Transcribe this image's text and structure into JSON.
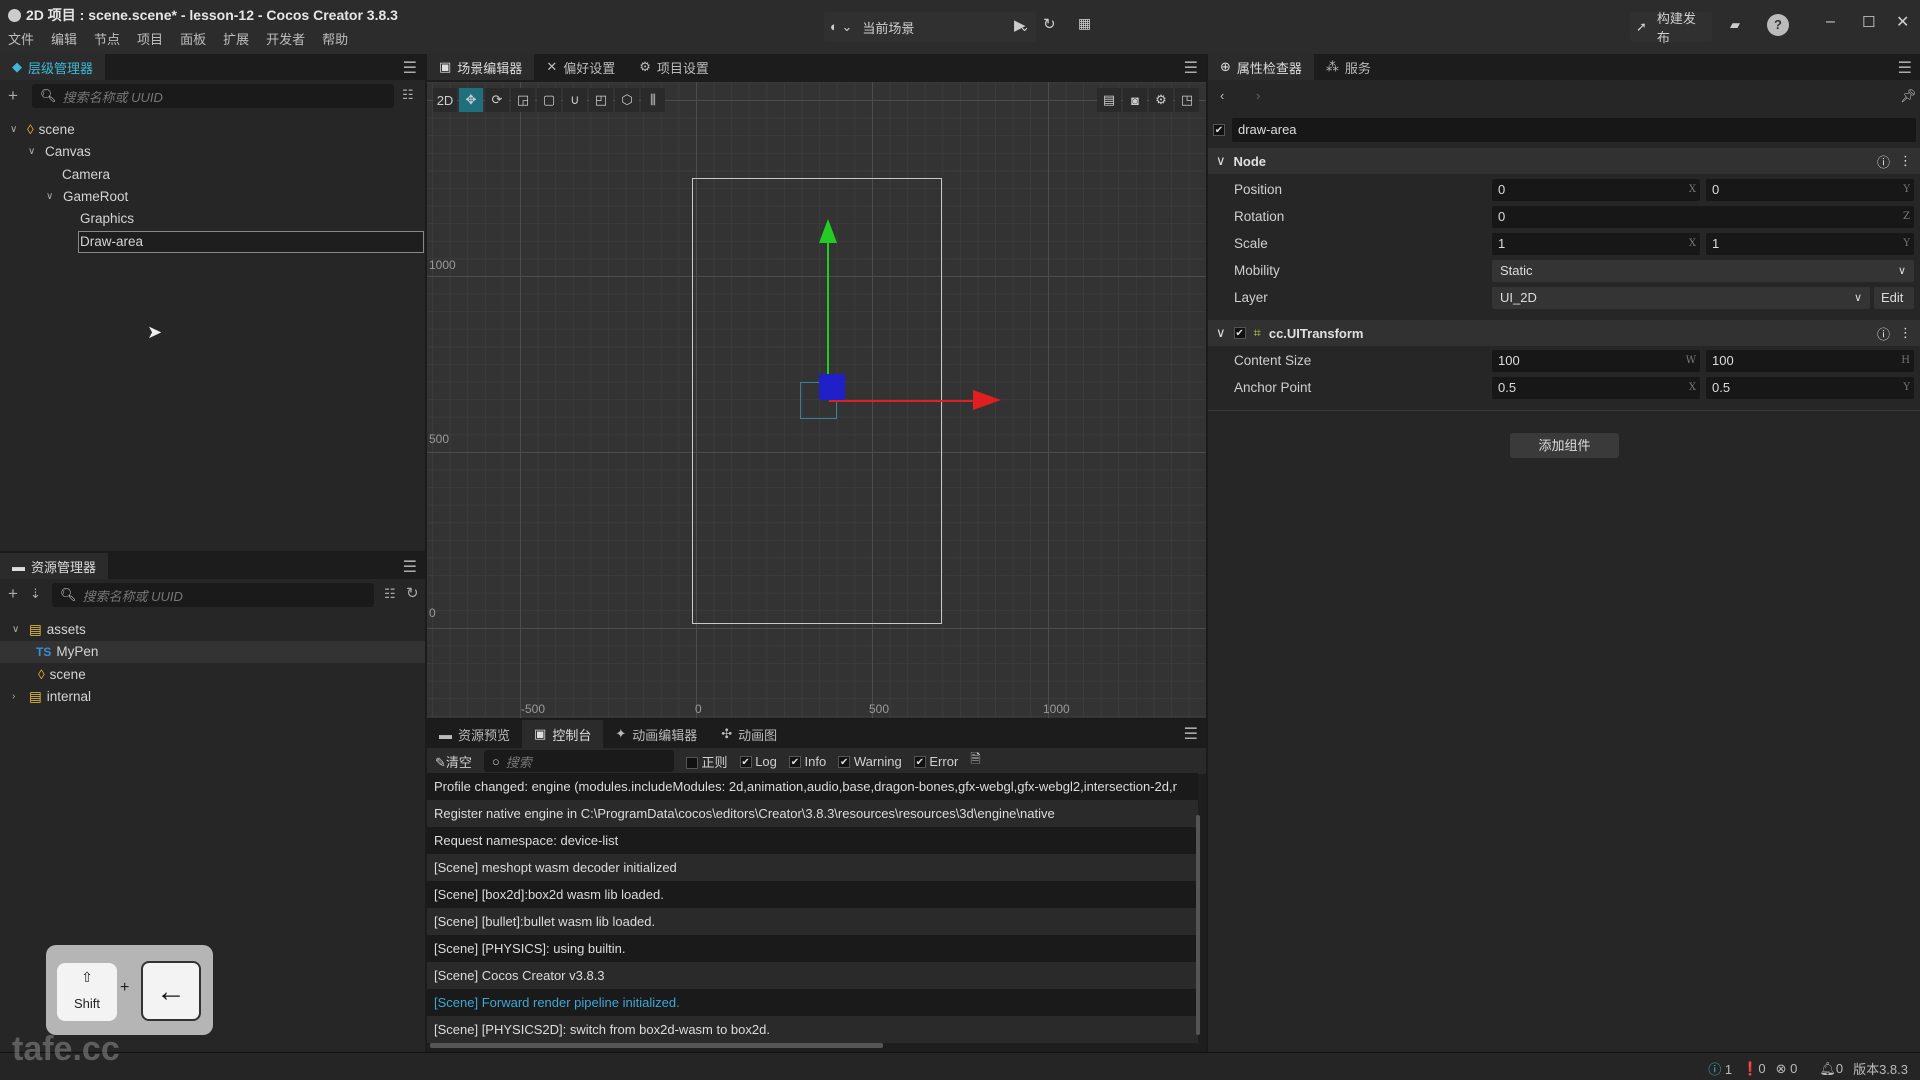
{
  "window": {
    "title": "2D 项目 : scene.scene* - lesson-12 - Cocos Creator 3.8.3"
  },
  "menu": [
    "文件",
    "编辑",
    "节点",
    "项目",
    "面板",
    "扩展",
    "开发者",
    "帮助"
  ],
  "toolbar": {
    "scene_select": "当前场景",
    "build_label": "构建发布"
  },
  "hierarchy": {
    "tab": "层级管理器",
    "search_placeholder": "搜索名称或 UUID",
    "nodes": [
      {
        "label": "scene",
        "depth": 0,
        "expanded": true
      },
      {
        "label": "Canvas",
        "depth": 1,
        "expanded": true
      },
      {
        "label": "Camera",
        "depth": 2
      },
      {
        "label": "GameRoot",
        "depth": 2,
        "expanded": true
      },
      {
        "label": "Graphics",
        "depth": 3
      },
      {
        "label": "Draw-area",
        "depth": 3,
        "editing": true
      }
    ]
  },
  "assets": {
    "tab": "资源管理器",
    "search_placeholder": "搜索名称或 UUID",
    "items": [
      {
        "label": "assets",
        "type": "folder",
        "expanded": true
      },
      {
        "label": "MyPen",
        "type": "ts",
        "badge": "TS"
      },
      {
        "label": "scene",
        "type": "scene"
      },
      {
        "label": "internal",
        "type": "folder",
        "expanded": false
      }
    ]
  },
  "scene_editor": {
    "tabs": [
      "场景编辑器",
      "偏好设置",
      "项目设置"
    ],
    "mode": "2D",
    "ruler_y": [
      "1000",
      "500",
      "0"
    ],
    "ruler_x": [
      "-500",
      "0",
      "500",
      "1000"
    ]
  },
  "console": {
    "tabs": [
      "资源预览",
      "控制台",
      "动画编辑器",
      "动画图"
    ],
    "clear": "清空",
    "search_placeholder": "搜索",
    "filters": [
      {
        "label": "正则",
        "checked": false
      },
      {
        "label": "Log",
        "checked": true
      },
      {
        "label": "Info",
        "checked": true
      },
      {
        "label": "Warning",
        "checked": true
      },
      {
        "label": "Error",
        "checked": true
      }
    ],
    "logs": [
      {
        "text": "Profile changed: engine (modules.includeModules: 2d,animation,audio,base,dragon-bones,gfx-webgl,gfx-webgl2,intersection-2d,r",
        "level": "log"
      },
      {
        "text": "Register native engine in C:\\ProgramData\\cocos\\editors\\Creator\\3.8.3\\resources\\resources\\3d\\engine\\native",
        "level": "log"
      },
      {
        "text": "Request namespace: device-list",
        "level": "log"
      },
      {
        "text": "[Scene] meshopt wasm decoder initialized",
        "level": "log"
      },
      {
        "text": "[Scene] [box2d]:box2d wasm lib loaded.",
        "level": "log"
      },
      {
        "text": "[Scene] [bullet]:bullet wasm lib loaded.",
        "level": "log"
      },
      {
        "text": "[Scene] [PHYSICS]: using builtin.",
        "level": "log"
      },
      {
        "text": "[Scene] Cocos Creator v3.8.3",
        "level": "log"
      },
      {
        "text": "[Scene] Forward render pipeline initialized.",
        "level": "info"
      },
      {
        "text": "[Scene] [PHYSICS2D]: switch from box2d-wasm to box2d.",
        "level": "log"
      }
    ]
  },
  "inspector": {
    "tabs": [
      "属性检查器",
      "服务"
    ],
    "node_name": "draw-area",
    "node_section": "Node",
    "position": {
      "label": "Position",
      "x": "0",
      "y": "0"
    },
    "rotation": {
      "label": "Rotation",
      "z": "0"
    },
    "scale": {
      "label": "Scale",
      "x": "1",
      "y": "1"
    },
    "mobility": {
      "label": "Mobility",
      "value": "Static"
    },
    "layer": {
      "label": "Layer",
      "value": "UI_2D",
      "edit": "Edit"
    },
    "uitransform": {
      "title": "cc.UITransform",
      "content_size": {
        "label": "Content Size",
        "w": "100",
        "h": "100"
      },
      "anchor": {
        "label": "Anchor Point",
        "x": "0.5",
        "y": "0.5"
      }
    },
    "add_component": "添加组件",
    "axis": {
      "x": "X",
      "y": "Y",
      "z": "Z",
      "w": "W",
      "h": "H"
    }
  },
  "status": {
    "info": "1",
    "warn": "0",
    "error": "0",
    "notify": "0",
    "version": "版本3.8.3"
  },
  "overlay": {
    "key1": "Shift",
    "plus": "+",
    "key1_glyph": "⇧",
    "key2_glyph": "←",
    "watermark": "tafe.cc"
  },
  "colors": {
    "accent": "#3db8d8",
    "info_log": "#3fa7d6",
    "gizmo_x": "#e02020",
    "gizmo_y": "#22cc22"
  }
}
